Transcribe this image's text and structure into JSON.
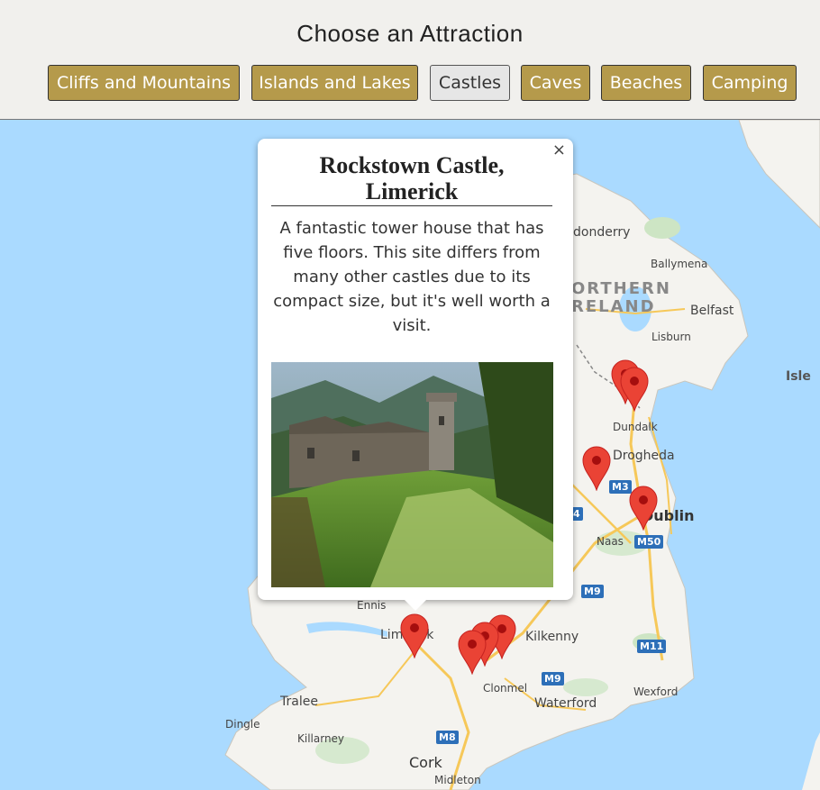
{
  "header": {
    "title": "Choose an Attraction",
    "categories": [
      {
        "label": "Cliffs and Mountains",
        "active": false
      },
      {
        "label": "Islands and Lakes",
        "active": false
      },
      {
        "label": "Castles",
        "active": true
      },
      {
        "label": "Caves",
        "active": false
      },
      {
        "label": "Beaches",
        "active": false
      },
      {
        "label": "Camping",
        "active": false
      }
    ]
  },
  "colors": {
    "accent": "#b59a4b",
    "header_bg": "#f1f0ed",
    "sea": "#aadaff",
    "land": "#f4f3ef",
    "marker": "#ea4335"
  },
  "map": {
    "places": {
      "derry": "donderry",
      "ballymena": "Ballymena",
      "northern": "ORTHERN",
      "ireland": "RELAND",
      "belfast": "Belfast",
      "lisburn": "Lisburn",
      "isle": "Isle",
      "dundalk": "Dundalk",
      "drogheda": "Drogheda",
      "dublin": "Dublin",
      "naas": "Naas",
      "ennis": "Ennis",
      "limerick": "Limerick",
      "kilkenny": "Kilkenny",
      "clonmel": "Clonmel",
      "waterford": "Waterford",
      "wexford": "Wexford",
      "tralee": "Tralee",
      "dingle": "Dingle",
      "killarney": "Killarney",
      "cork": "Cork",
      "midleton": "Midleton"
    },
    "roads": {
      "m3": "M3",
      "m50": "M50",
      "m9a": "M9",
      "m9b": "M9",
      "m11": "M11",
      "m8": "M8",
      "m4": "4"
    }
  },
  "infowindow": {
    "title": "Rockstown Castle, Limerick",
    "description": "A fantastic tower house that has five floors. This site differs from many other castles due to its compact size, but it's well worth a visit.",
    "close_label": "×",
    "image_alt": "ruined stone tower in green valley"
  }
}
